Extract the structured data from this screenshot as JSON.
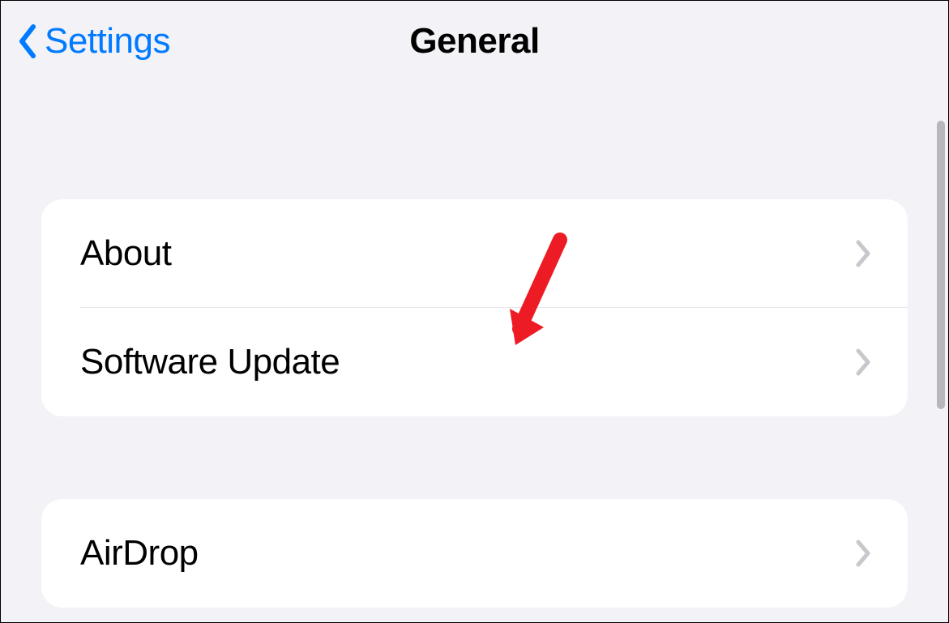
{
  "nav": {
    "back_label": "Settings",
    "title": "General"
  },
  "groups": [
    {
      "items": [
        {
          "label": "About"
        },
        {
          "label": "Software Update"
        }
      ]
    },
    {
      "items": [
        {
          "label": "AirDrop"
        }
      ]
    }
  ],
  "colors": {
    "link": "#007aff",
    "background": "#f2f2f7",
    "chevron": "#c7c7cc",
    "annotation": "#ed1c24"
  }
}
